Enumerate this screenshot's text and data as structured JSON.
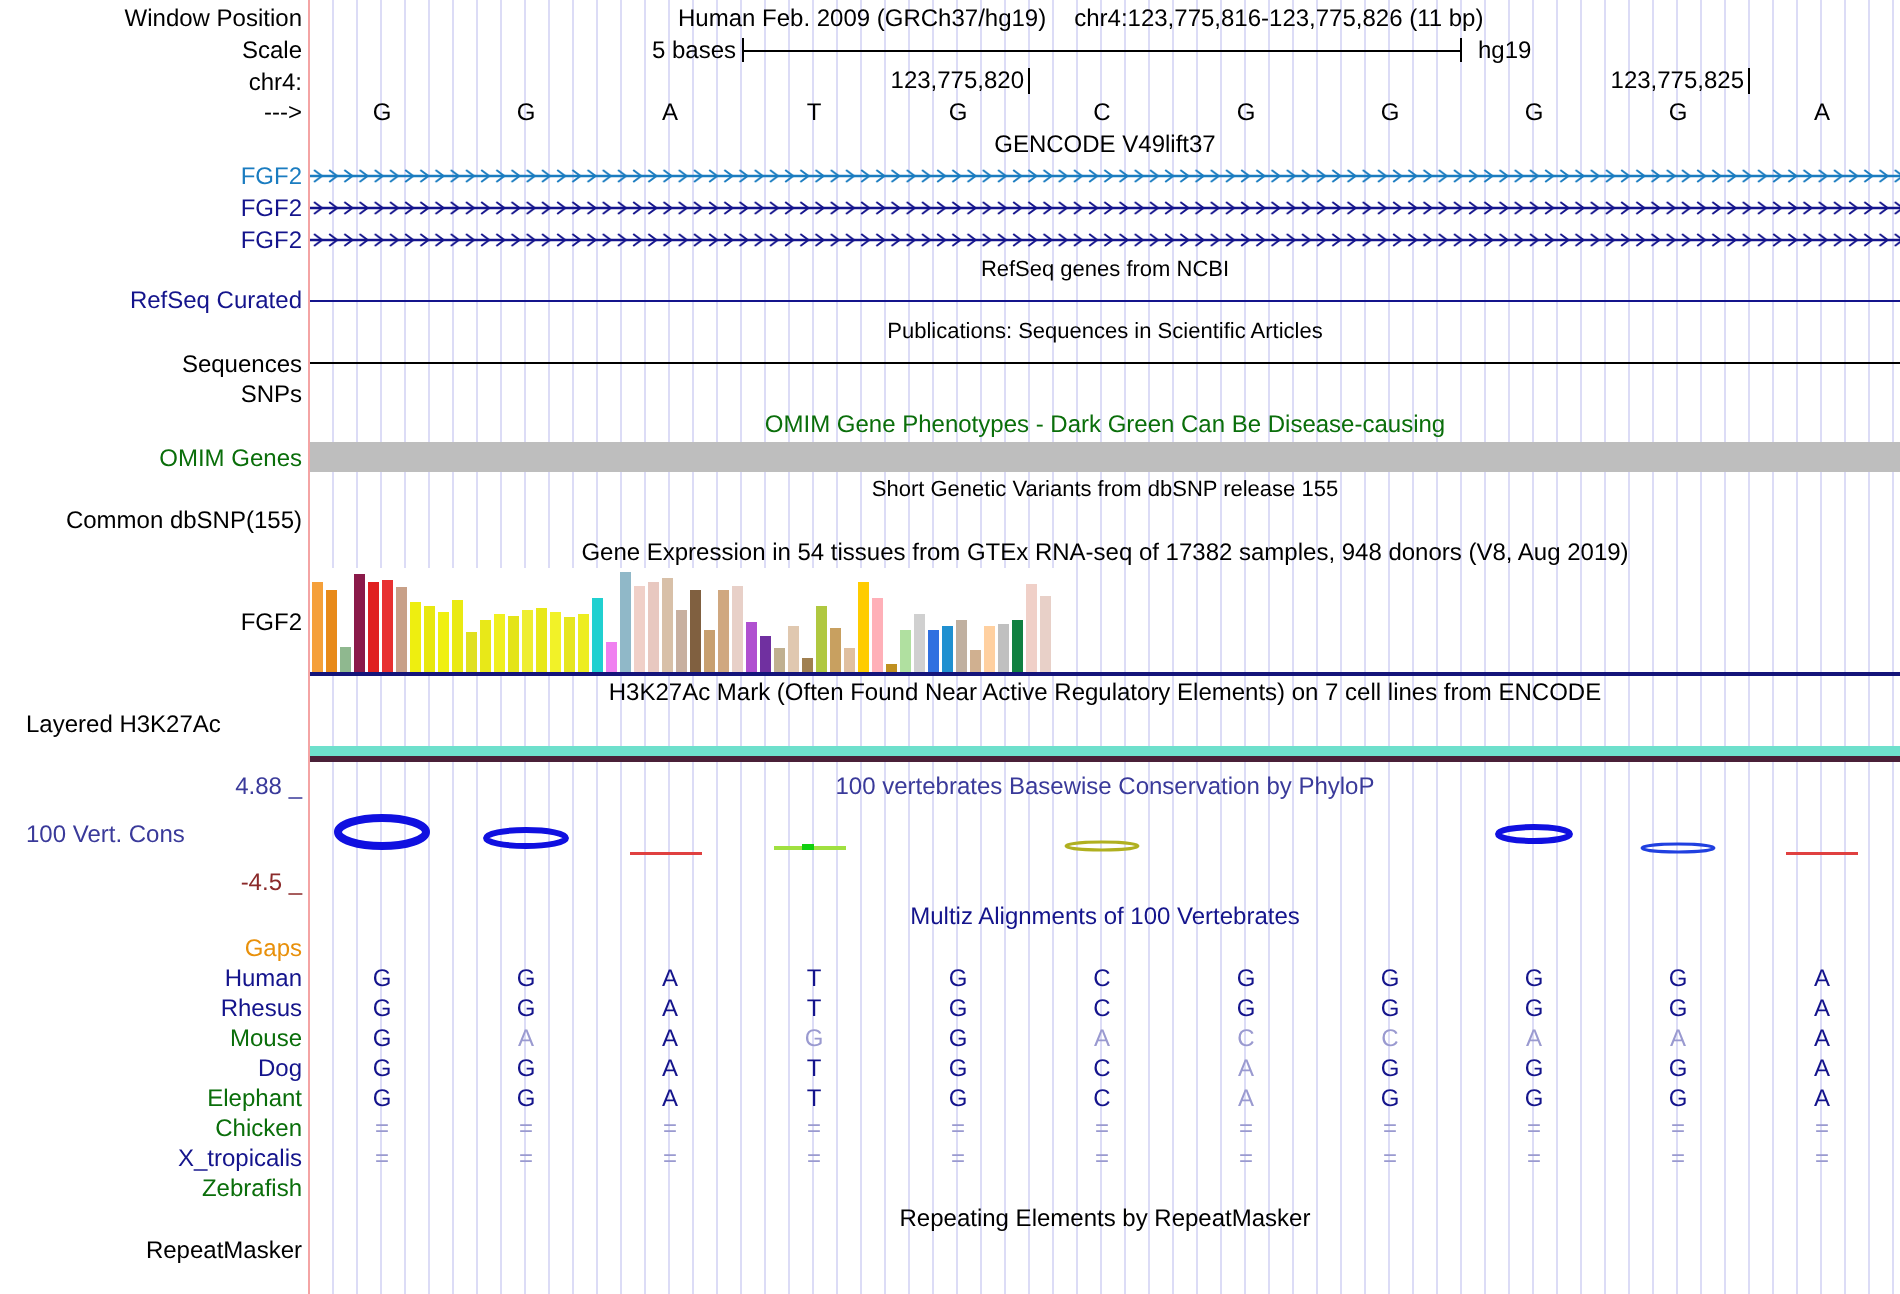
{
  "header": {
    "window_label": "Window Position",
    "assembly": "Human Feb. 2009 (GRCh37/hg19)",
    "position": "chr4:123,775,816-123,775,826 (11 bp)",
    "scale_label": "Scale",
    "scale_text": "5 bases",
    "scale_db": "hg19",
    "chrom_label": "chr4:",
    "coord_ticks": [
      "123,775,820",
      "123,775,825"
    ],
    "strand_label": "--->",
    "bases": [
      "G",
      "G",
      "A",
      "T",
      "G",
      "C",
      "G",
      "G",
      "G",
      "G",
      "A"
    ]
  },
  "gencode": {
    "title": "GENCODE V49lift37",
    "transcripts": [
      {
        "label": "FGF2",
        "color": "#1a7cc0"
      },
      {
        "label": "FGF2",
        "color": "#14148c"
      },
      {
        "label": "FGF2",
        "color": "#14148c"
      }
    ]
  },
  "refseq": {
    "title": "RefSeq genes from NCBI",
    "label": "RefSeq Curated"
  },
  "publications": {
    "title": "Publications: Sequences in Scientific Articles",
    "labels": [
      "Sequences",
      "SNPs"
    ]
  },
  "omim": {
    "title": "OMIM Gene Phenotypes - Dark Green Can Be Disease-causing",
    "label": "OMIM Genes"
  },
  "dbsnp": {
    "title": "Short Genetic Variants from dbSNP release 155",
    "label": "Common dbSNP(155)"
  },
  "gtex": {
    "title": "Gene Expression in 54 tissues from GTEx RNA-seq of 17382 samples, 948 donors (V8, Aug 2019)",
    "label": "FGF2"
  },
  "h3k27ac": {
    "title": "H3K27Ac Mark (Often Found Near Active Regulatory Elements) on 7 cell lines from ENCODE",
    "label": "Layered H3K27Ac"
  },
  "phylop": {
    "title": "100 vertebrates Basewise Conservation by PhyloP",
    "label": "100 Vert. Cons",
    "y_max": "4.88 _",
    "y_min": "-4.5 _"
  },
  "multiz": {
    "title": "Multiz Alignments of 100 Vertebrates",
    "species": [
      {
        "name": "Gaps",
        "color": "#e8900a"
      },
      {
        "name": "Human",
        "color": "#14148c",
        "bases": [
          {
            "b": "G",
            "match": true
          },
          {
            "b": "G",
            "match": true
          },
          {
            "b": "A",
            "match": true
          },
          {
            "b": "T",
            "match": true
          },
          {
            "b": "G",
            "match": true
          },
          {
            "b": "C",
            "match": true
          },
          {
            "b": "G",
            "match": true
          },
          {
            "b": "G",
            "match": true
          },
          {
            "b": "G",
            "match": true
          },
          {
            "b": "G",
            "match": true
          },
          {
            "b": "A",
            "match": true
          }
        ]
      },
      {
        "name": "Rhesus",
        "color": "#14148c",
        "bases": [
          {
            "b": "G",
            "match": true
          },
          {
            "b": "G",
            "match": true
          },
          {
            "b": "A",
            "match": true
          },
          {
            "b": "T",
            "match": true
          },
          {
            "b": "G",
            "match": true
          },
          {
            "b": "C",
            "match": true
          },
          {
            "b": "G",
            "match": true
          },
          {
            "b": "G",
            "match": true
          },
          {
            "b": "G",
            "match": true
          },
          {
            "b": "G",
            "match": true
          },
          {
            "b": "A",
            "match": true
          }
        ]
      },
      {
        "name": "Mouse",
        "color": "#0a6e0a",
        "bases": [
          {
            "b": "G",
            "match": true
          },
          {
            "b": "A",
            "match": false
          },
          {
            "b": "A",
            "match": true
          },
          {
            "b": "G",
            "match": false
          },
          {
            "b": "G",
            "match": true
          },
          {
            "b": "A",
            "match": false
          },
          {
            "b": "C",
            "match": false
          },
          {
            "b": "C",
            "match": false
          },
          {
            "b": "A",
            "match": false
          },
          {
            "b": "A",
            "match": false
          },
          {
            "b": "A",
            "match": true
          }
        ]
      },
      {
        "name": "Dog",
        "color": "#14148c",
        "bases": [
          {
            "b": "G",
            "match": true
          },
          {
            "b": "G",
            "match": true
          },
          {
            "b": "A",
            "match": true
          },
          {
            "b": "T",
            "match": true
          },
          {
            "b": "G",
            "match": true
          },
          {
            "b": "C",
            "match": true
          },
          {
            "b": "A",
            "match": false
          },
          {
            "b": "G",
            "match": true
          },
          {
            "b": "G",
            "match": true
          },
          {
            "b": "G",
            "match": true
          },
          {
            "b": "A",
            "match": true
          }
        ]
      },
      {
        "name": "Elephant",
        "color": "#0a6e0a",
        "bases": [
          {
            "b": "G",
            "match": true
          },
          {
            "b": "G",
            "match": true
          },
          {
            "b": "A",
            "match": true
          },
          {
            "b": "T",
            "match": true
          },
          {
            "b": "G",
            "match": true
          },
          {
            "b": "C",
            "match": true
          },
          {
            "b": "A",
            "match": false
          },
          {
            "b": "G",
            "match": true
          },
          {
            "b": "G",
            "match": true
          },
          {
            "b": "G",
            "match": true
          },
          {
            "b": "A",
            "match": true
          }
        ]
      },
      {
        "name": "Chicken",
        "color": "#0a6e0a",
        "bases": [
          {
            "b": "=",
            "match": false
          },
          {
            "b": "=",
            "match": false
          },
          {
            "b": "=",
            "match": false
          },
          {
            "b": "=",
            "match": false
          },
          {
            "b": "=",
            "match": false
          },
          {
            "b": "=",
            "match": false
          },
          {
            "b": "=",
            "match": false
          },
          {
            "b": "=",
            "match": false
          },
          {
            "b": "=",
            "match": false
          },
          {
            "b": "=",
            "match": false
          },
          {
            "b": "=",
            "match": false
          }
        ]
      },
      {
        "name": "X_tropicalis",
        "color": "#14148c",
        "bases": [
          {
            "b": "=",
            "match": false
          },
          {
            "b": "=",
            "match": false
          },
          {
            "b": "=",
            "match": false
          },
          {
            "b": "=",
            "match": false
          },
          {
            "b": "=",
            "match": false
          },
          {
            "b": "=",
            "match": false
          },
          {
            "b": "=",
            "match": false
          },
          {
            "b": "=",
            "match": false
          },
          {
            "b": "=",
            "match": false
          },
          {
            "b": "=",
            "match": false
          },
          {
            "b": "=",
            "match": false
          }
        ]
      },
      {
        "name": "Zebrafish",
        "color": "#0a6e0a"
      }
    ]
  },
  "repeatmasker": {
    "title": "Repeating Elements by RepeatMasker",
    "label": "RepeatMasker"
  }
}
